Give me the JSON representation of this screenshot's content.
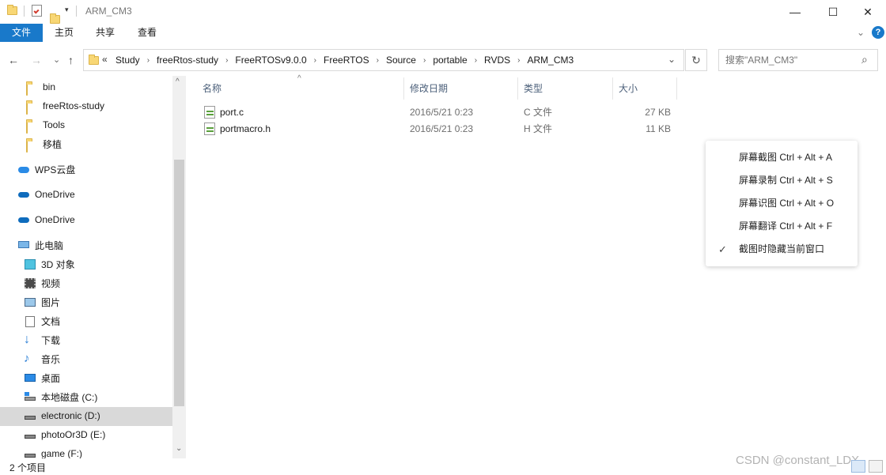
{
  "window": {
    "title": "ARM_CM3",
    "minimize_glyph": "—",
    "maximize_glyph": "☐",
    "close_glyph": "✕"
  },
  "ribbon": {
    "tabs": [
      {
        "label": "文件",
        "active": true
      },
      {
        "label": "主页"
      },
      {
        "label": "共享"
      },
      {
        "label": "查看"
      }
    ]
  },
  "nav": {
    "back_glyph": "←",
    "forward_glyph": "→",
    "recent_glyph": "⌄",
    "up_glyph": "↑",
    "overflow": "«",
    "breadcrumbs": [
      "Study",
      "freeRtos-study",
      "FreeRTOSv9.0.0",
      "FreeRTOS",
      "Source",
      "portable",
      "RVDS",
      "ARM_CM3"
    ],
    "separator": "›",
    "dropdown_glyph": "⌄",
    "refresh_glyph": "↻",
    "search_placeholder": "搜索\"ARM_CM3\"",
    "search_icon_glyph": "⌕"
  },
  "navpane": {
    "items": [
      {
        "label": "bin",
        "icon": "folder-icon",
        "indent": 2
      },
      {
        "label": "freeRtos-study",
        "icon": "folder-icon",
        "indent": 2
      },
      {
        "label": "Tools",
        "icon": "folder-icon",
        "indent": 2
      },
      {
        "label": "移植",
        "icon": "folder-icon",
        "indent": 2
      },
      {
        "label": "WPS云盘",
        "icon": "cloud-icon",
        "indent": 1
      },
      {
        "label": "OneDrive",
        "icon": "onedrive-icon",
        "indent": 1
      },
      {
        "label": "OneDrive",
        "icon": "onedrive-icon",
        "indent": 1
      },
      {
        "label": "此电脑",
        "icon": "computer-icon",
        "indent": 1
      },
      {
        "label": "3D 对象",
        "icon": "cube-icon",
        "indent": 2
      },
      {
        "label": "视频",
        "icon": "video-icon",
        "indent": 2
      },
      {
        "label": "图片",
        "icon": "picture-icon",
        "indent": 2
      },
      {
        "label": "文档",
        "icon": "document-icon",
        "indent": 2
      },
      {
        "label": "下载",
        "icon": "download-icon",
        "indent": 2
      },
      {
        "label": "音乐",
        "icon": "music-icon",
        "indent": 2
      },
      {
        "label": "桌面",
        "icon": "desktop-icon",
        "indent": 2
      },
      {
        "label": "本地磁盘 (C:)",
        "icon": "system-drive-icon",
        "indent": 2
      },
      {
        "label": "electronic (D:)",
        "icon": "drive-icon",
        "indent": 2,
        "selected": true
      },
      {
        "label": "photoOr3D (E:)",
        "icon": "drive-icon",
        "indent": 2
      },
      {
        "label": "game (F:)",
        "icon": "drive-icon",
        "indent": 2
      }
    ],
    "scroll_up_glyph": "^",
    "scroll_down_glyph": "⌄"
  },
  "filelist": {
    "sort_glyph": "^",
    "columns": [
      "名称",
      "修改日期",
      "类型",
      "大小"
    ],
    "files": [
      {
        "name": "port.c",
        "date": "2016/5/21 0:23",
        "type": "C 文件",
        "size": "27 KB"
      },
      {
        "name": "portmacro.h",
        "date": "2016/5/21 0:23",
        "type": "H 文件",
        "size": "11 KB"
      }
    ]
  },
  "context_menu": {
    "items": [
      {
        "label": "屏幕截图 Ctrl + Alt + A",
        "checked": false
      },
      {
        "label": "屏幕录制 Ctrl + Alt + S",
        "checked": false
      },
      {
        "label": "屏幕识图 Ctrl + Alt + O",
        "checked": false
      },
      {
        "label": "屏幕翻译 Ctrl + Alt + F",
        "checked": false
      },
      {
        "label": "截图时隐藏当前窗口",
        "checked": true
      }
    ],
    "check_glyph": "✓"
  },
  "status": {
    "item_count": "2 个项目",
    "watermark": "CSDN @constant_LDX"
  },
  "colors": {
    "accent": "#1979ca",
    "selection": "#d9d9d9",
    "header_text": "#4c607a"
  }
}
